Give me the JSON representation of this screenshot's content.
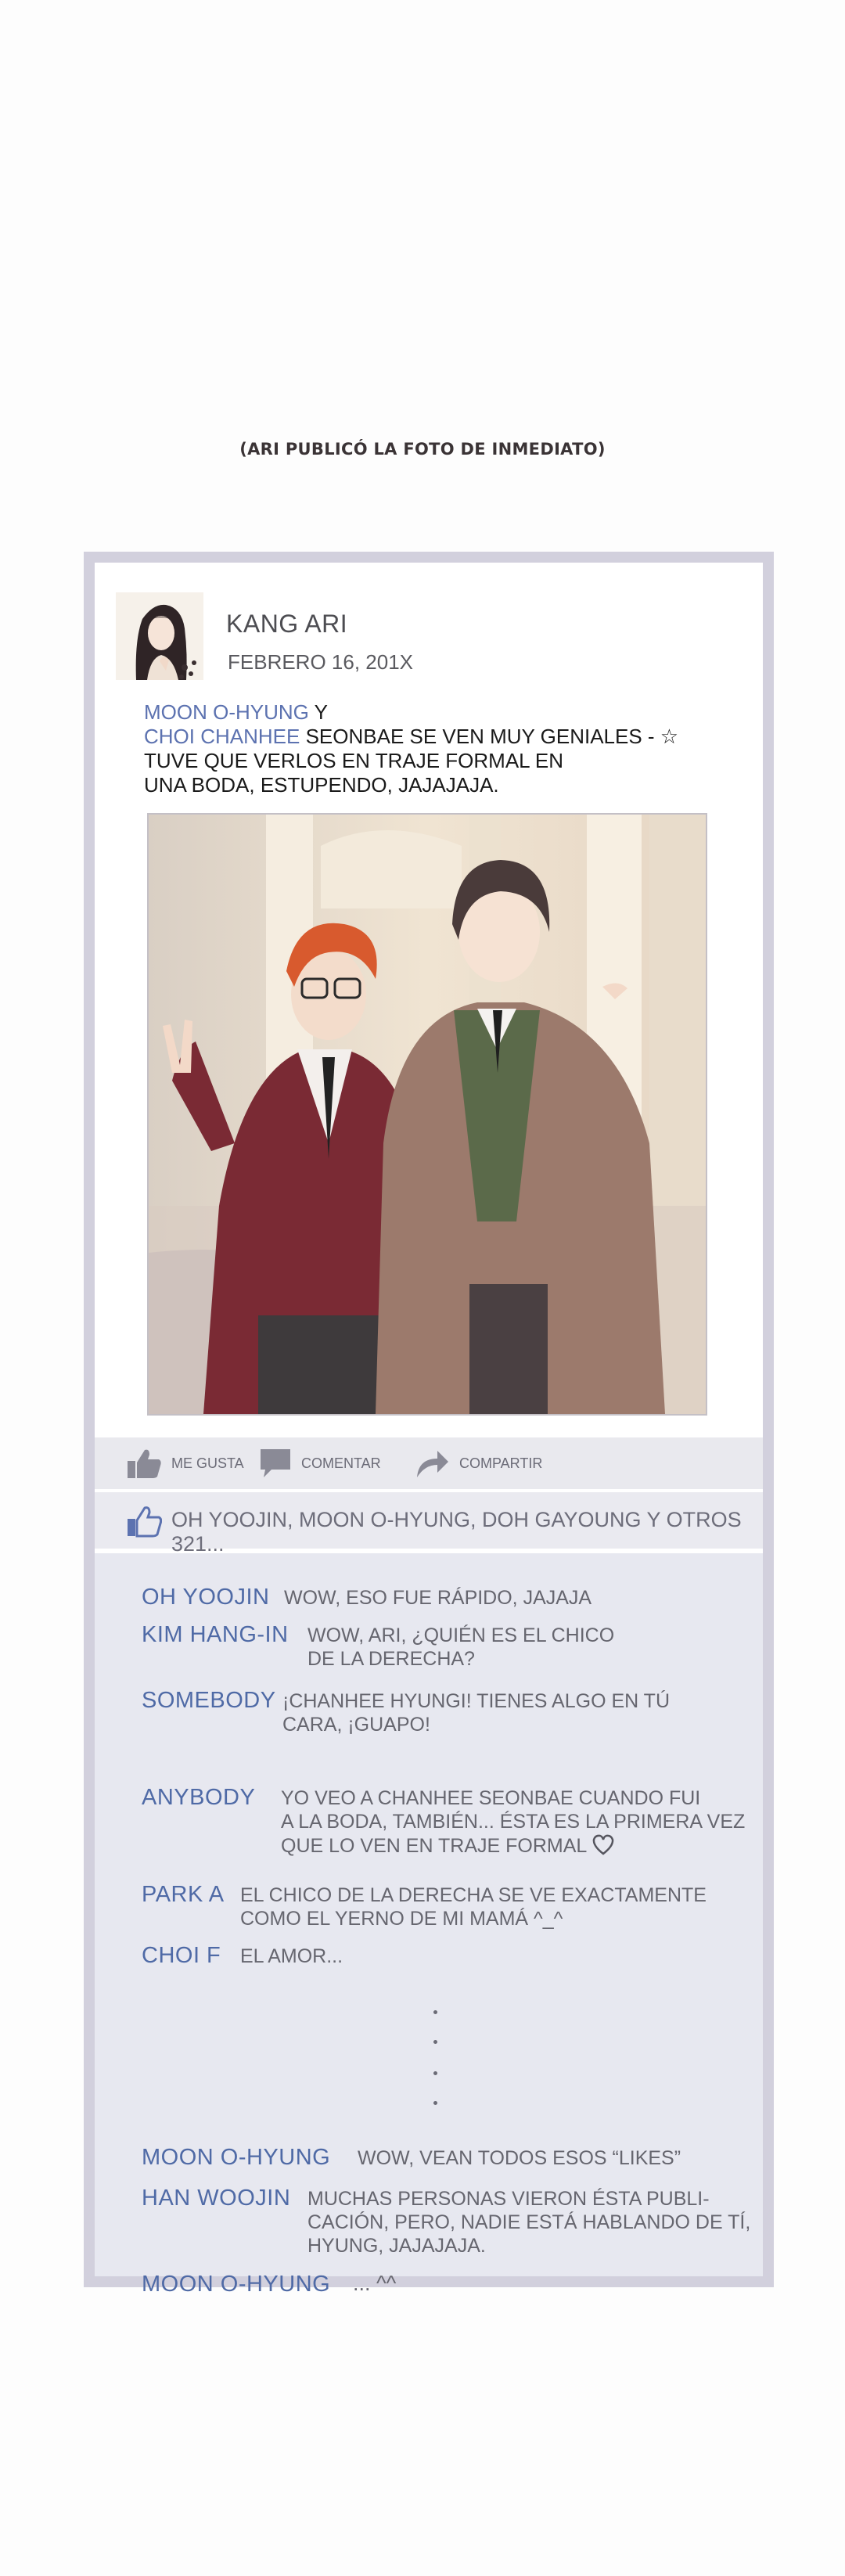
{
  "caption": "(ARI PUBLICÓ LA FOTO DE INMEDIATO)",
  "post": {
    "author": "KANG ARI",
    "date": "FEBRERO 16, 201X",
    "tag1": "MOON O-HYUNG",
    "and": " Y",
    "tag2": "CHOI CHANHEE",
    "text_line1_rest": " SEONBAE SE VEN MUY GENIALES - ☆",
    "text_line3": "TUVE QUE VERLOS EN TRAJE FORMAL EN",
    "text_line4": "UNA BODA, ESTUPENDO, JAJAJAJA."
  },
  "actions": {
    "like": "ME GUSTA",
    "comment": "COMENTAR",
    "share": "COMPARTIR"
  },
  "likes_summary": "OH YOOJIN, MOON O-HYUNG, DOH GAYOUNG Y OTROS 321...",
  "comments": [
    {
      "name": "OH YOOJIN",
      "lines": [
        "WOW, ESO FUE RÁPIDO, JAJAJA"
      ]
    },
    {
      "name": "KIM HANG-IN",
      "lines": [
        "WOW, ARI, ¿QUIÉN ES EL CHICO",
        "DE LA DERECHA?"
      ]
    },
    {
      "name": "SOMEBODY",
      "lines": [
        "¡CHANHEE HYUNGI! TIENES ALGO EN TÚ",
        "CARA, ¡GUAPO!"
      ]
    },
    {
      "name": "ANYBODY",
      "lines": [
        "YO VEO A CHANHEE SEONBAE CUANDO FUI",
        "A LA BODA, TAMBIÉN... ÉSTA ES LA PRIMERA VEZ",
        "QUE LO VEN EN TRAJE FORMAL"
      ]
    },
    {
      "name": "PARK A",
      "lines": [
        "EL CHICO DE LA DERECHA SE VE EXACTAMENTE",
        "COMO EL YERNO DE MI MAMÁ ^_^"
      ]
    },
    {
      "name": "CHOI F",
      "lines": [
        "EL AMOR..."
      ]
    },
    {
      "name": "MOON O-HYUNG",
      "lines": [
        "WOW, VEAN TODOS ESOS “LIKES”"
      ]
    },
    {
      "name": "HAN WOOJIN",
      "lines": [
        "MUCHAS PERSONAS VIERON ÉSTA PUBLI-",
        "CACIÓN, PERO, NADIE ESTÁ HABLANDO DE TÍ,",
        "HYUNG, JAJAJAJA."
      ]
    },
    {
      "name": "MOON O-HYUNG",
      "lines": [
        "... ^^"
      ]
    }
  ],
  "colors": {
    "frame": "#d2d0dd",
    "comment_bg": "#e7e8f0",
    "name_blue": "#4f6aa6",
    "tag_blue": "#5c72b0"
  }
}
